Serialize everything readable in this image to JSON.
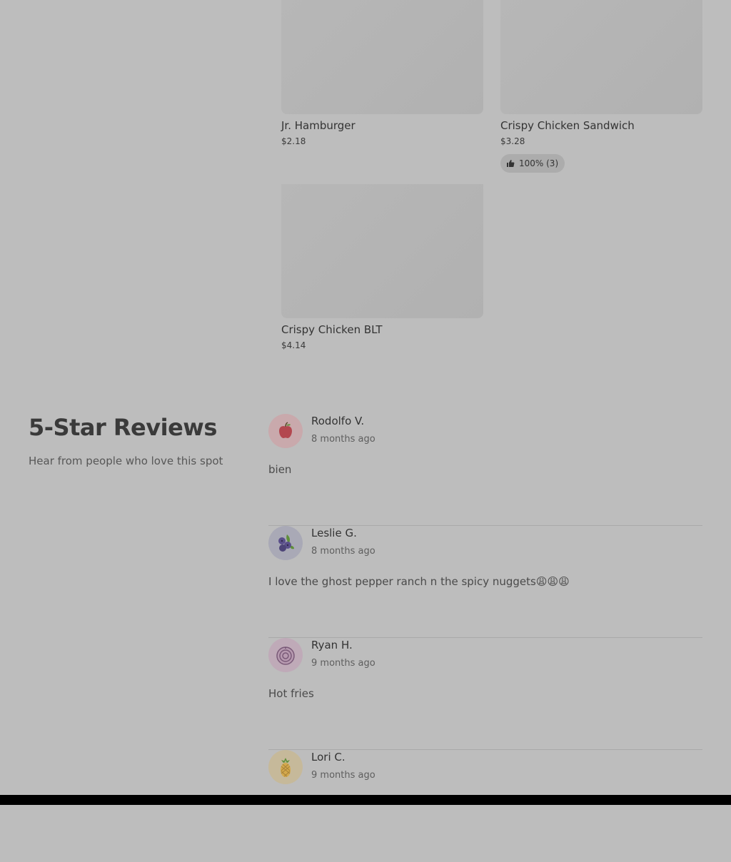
{
  "menu_items": [
    {
      "name": "Jr. Hamburger",
      "price": "$2.18"
    },
    {
      "name": "Crispy Chicken Sandwich",
      "price": "$3.28",
      "rating": "100% (3)"
    },
    {
      "name": "Crispy Chicken BLT",
      "price": "$4.14"
    }
  ],
  "reviews_section": {
    "title": "5-Star Reviews",
    "subtitle": "Hear from people who love this spot"
  },
  "reviews": [
    {
      "name": "Rodolfo V.",
      "date": "8 months ago",
      "text": "bien",
      "avatar_icon": "apple-icon"
    },
    {
      "name": "Leslie G.",
      "date": "8 months ago",
      "text": "I love the ghost pepper ranch n the spicy nuggets😩😩😩",
      "avatar_icon": "blueberry-icon"
    },
    {
      "name": "Ryan H.",
      "date": "9 months ago",
      "text": "Hot fries",
      "avatar_icon": "onion-icon"
    },
    {
      "name": "Lori C.",
      "date": "9 months ago",
      "text": "",
      "avatar_icon": "pineapple-icon"
    }
  ],
  "colors": {
    "overlay": "#bdbdbd",
    "bottom_bar": "#000000"
  }
}
